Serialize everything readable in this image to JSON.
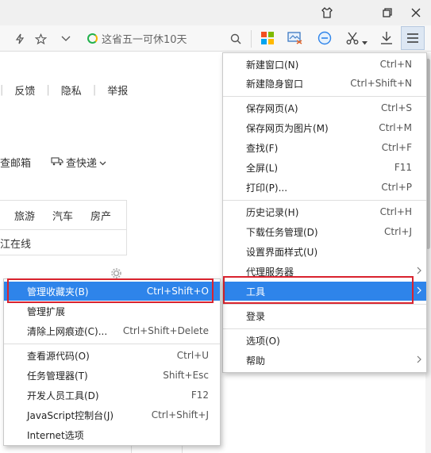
{
  "toolbar": {
    "search_hint": "这省五一可休10天"
  },
  "page": {
    "footer_links": [
      "反馈",
      "隐私",
      "举报"
    ],
    "mail_label": "查邮箱",
    "express_label": "查快递",
    "news_tabs": [
      "旅游",
      "汽车",
      "房产"
    ],
    "news_item": "江在线"
  },
  "main_menu": {
    "items": [
      {
        "label": "新建窗口(N)",
        "shortcut": "Ctrl+N"
      },
      {
        "label": "新建隐身窗口",
        "shortcut": "Ctrl+Shift+N"
      },
      {
        "label": "保存网页(A)",
        "shortcut": "Ctrl+S"
      },
      {
        "label": "保存网页为图片(M)",
        "shortcut": "Ctrl+M"
      },
      {
        "label": "查找(F)",
        "shortcut": "Ctrl+F"
      },
      {
        "label": "全屏(L)",
        "shortcut": "F11"
      },
      {
        "label": "打印(P)...",
        "shortcut": "Ctrl+P"
      },
      {
        "label": "历史记录(H)",
        "shortcut": "Ctrl+H"
      },
      {
        "label": "下载任务管理(D)",
        "shortcut": "Ctrl+J"
      },
      {
        "label": "设置界面样式(U)",
        "shortcut": ""
      },
      {
        "label": "代理服务器",
        "shortcut": ""
      },
      {
        "label": "工具",
        "shortcut": ""
      },
      {
        "label": "登录",
        "shortcut": ""
      },
      {
        "label": "选项(O)",
        "shortcut": ""
      },
      {
        "label": "帮助",
        "shortcut": ""
      }
    ]
  },
  "tools_submenu": {
    "items": [
      {
        "label": "管理收藏夹(B)",
        "shortcut": "Ctrl+Shift+O"
      },
      {
        "label": "管理扩展",
        "shortcut": ""
      },
      {
        "label": "清除上网痕迹(C)...",
        "shortcut": "Ctrl+Shift+Delete"
      },
      {
        "label": "查看源代码(O)",
        "shortcut": "Ctrl+U"
      },
      {
        "label": "任务管理器(T)",
        "shortcut": "Shift+Esc"
      },
      {
        "label": "开发人员工具(D)",
        "shortcut": "F12"
      },
      {
        "label": "JavaScript控制台(J)",
        "shortcut": "Ctrl+Shift+J"
      },
      {
        "label": "Internet选项",
        "shortcut": ""
      }
    ]
  },
  "colors": {
    "highlight": "#2e84ea",
    "annotation_box": "#d9232e"
  },
  "icons": {
    "titlebar": [
      "skin-icon",
      "restore-icon",
      "close-icon"
    ],
    "toolbar": [
      "lightning-icon",
      "star-icon",
      "chevron-down-icon",
      "search-icon",
      "windows-apps-icon",
      "screenshot-icon",
      "minus-circle-icon",
      "scissors-icon",
      "download-icon",
      "menu-icon"
    ]
  }
}
